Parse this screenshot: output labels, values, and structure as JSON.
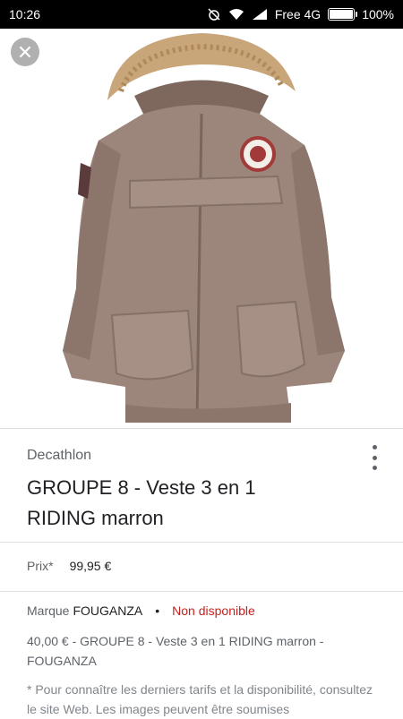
{
  "status_bar": {
    "time": "10:26",
    "network": "Free 4G",
    "battery": "100%"
  },
  "product": {
    "merchant": "Decathlon",
    "title": "GROUPE 8 - Veste 3 en 1 RIDING marron",
    "price_label": "Prix*",
    "price": "99,95 €",
    "brand_label": "Marque",
    "brand": "FOUGANZA",
    "separator": "•",
    "availability": "Non disponible",
    "description": "40,00 € - GROUPE 8 - Veste 3 en 1 RIDING marron - FOUGANZA",
    "note": "* Pour connaître les derniers tarifs et la disponibilité, consultez le site Web. Les images peuvent être soumises"
  },
  "icons": {
    "close": "close-icon",
    "more": "more-vert-icon"
  },
  "colors": {
    "jacket": "#9c857b",
    "fur": "#c9a57a",
    "availability": "#c5221f"
  }
}
